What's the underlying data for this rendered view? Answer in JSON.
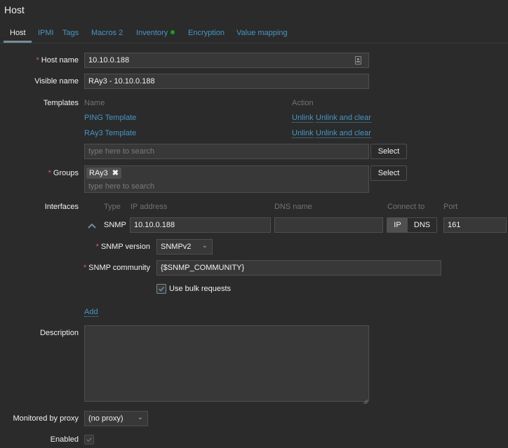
{
  "page": {
    "title": "Host"
  },
  "tabs": [
    {
      "label": "Host",
      "active": true
    },
    {
      "label": "IPMI"
    },
    {
      "label": "Tags"
    },
    {
      "label": "Macros 2"
    },
    {
      "label": "Inventory"
    },
    {
      "label": "Encryption"
    },
    {
      "label": "Value mapping"
    }
  ],
  "colors": {
    "accent": "#4796c4",
    "required": "#e45959",
    "inventory_dot": "#1a9c1a",
    "background": "#2b2b2b",
    "input_bg": "#383838"
  },
  "form": {
    "host_name": {
      "label": "Host name",
      "value": "10.10.0.188",
      "required": true
    },
    "visible_name": {
      "label": "Visible name",
      "value": "RAy3 - 10.10.0.188"
    },
    "templates": {
      "label": "Templates",
      "col_name": "Name",
      "col_action": "Action",
      "rows": [
        {
          "name": "PING Template",
          "unlink": "Unlink",
          "unlink_clear": "Unlink and clear"
        },
        {
          "name": "RAy3 Template",
          "unlink": "Unlink",
          "unlink_clear": "Unlink and clear"
        }
      ],
      "search_placeholder": "type here to search",
      "select_label": "Select"
    },
    "groups": {
      "label": "Groups",
      "required": true,
      "tags": [
        "RAy3"
      ],
      "search_placeholder": "type here to search",
      "select_label": "Select"
    },
    "interfaces": {
      "label": "Interfaces",
      "col_type": "Type",
      "col_ip": "IP address",
      "col_dns": "DNS name",
      "col_connect": "Connect to",
      "col_port": "Port",
      "row": {
        "type": "SNMP",
        "ip": "10.10.0.188",
        "dns": "",
        "connect_ip": "IP",
        "connect_dns": "DNS",
        "port": "161",
        "snmp_version_label": "SNMP version",
        "snmp_version": "SNMPv2",
        "snmp_community_label": "SNMP community",
        "snmp_community": "{$SNMP_COMMUNITY}",
        "bulk_label": "Use bulk requests",
        "bulk_checked": true
      },
      "add_label": "Add"
    },
    "description": {
      "label": "Description",
      "value": ""
    },
    "proxy": {
      "label": "Monitored by proxy",
      "value": "(no proxy)"
    },
    "enabled": {
      "label": "Enabled",
      "checked": true
    }
  }
}
